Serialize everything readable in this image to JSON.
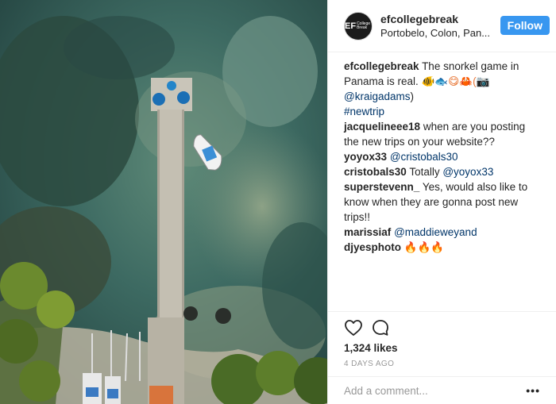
{
  "post": {
    "username": "efcollegebreak",
    "location": "Portobelo, Colon, Pan...",
    "avatar_text": "EF",
    "avatar_subtext": "College Break",
    "follow_label": "Follow",
    "caption": {
      "author": "efcollegebreak",
      "text": "The snorkel game in Panama is real.",
      "emoji": "🐠🐟😋🦀(📷",
      "mention": "@kraigadams",
      "closing": ")",
      "hashtag": "#newtrip"
    },
    "comments": [
      {
        "author": "jacquelineee18",
        "text": "when are you posting the new trips on your website??",
        "mention": ""
      },
      {
        "author": "yoyox33",
        "text": "",
        "mention": "@cristobals30"
      },
      {
        "author": "cristobals30",
        "text": "Totally",
        "mention": "@yoyox33"
      },
      {
        "author": "superstevenn_",
        "text": "Yes, would also like to know when they are gonna post new trips!!",
        "mention": ""
      },
      {
        "author": "marissiaf",
        "text": "",
        "mention": "@maddieweyand"
      },
      {
        "author": "djyesphoto",
        "text": "🔥🔥🔥",
        "mention": ""
      }
    ],
    "likes": "1,324 likes",
    "time": "4 DAYS AGO",
    "add_comment_placeholder": "Add a comment...",
    "more_label": "•••"
  },
  "icons": {
    "like": "heart-icon",
    "comment": "comment-bubble-icon",
    "more": "more-options-icon"
  },
  "colors": {
    "follow_button": "#3897f0",
    "mention": "#003569",
    "muted": "#999999"
  }
}
